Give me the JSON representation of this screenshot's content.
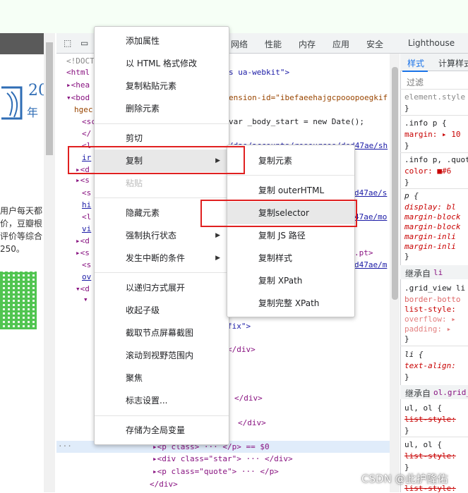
{
  "page": {
    "logo_num": "20",
    "logo_sub": "年度",
    "text_lines": [
      "用户每天都",
      "价，豆瓣根",
      "评价等综合",
      "250。"
    ]
  },
  "devtools": {
    "tabs": [
      "网络",
      "性能",
      "内存",
      "应用",
      "安全",
      "Lighthouse"
    ],
    "code": [
      {
        "a": "<!DOCT",
        "b": ""
      },
      {
        "a": "<html",
        "b": "s ua-webkit\">"
      },
      {
        "a": "▸<hea",
        "b": ""
      },
      {
        "a": "▾<bod",
        "b": "ension-id=\"ibefaeehajgcpooopoegkif"
      },
      {
        "a": "hgec",
        "b": ""
      },
      {
        "a": "<sc",
        "b": "var _body_start = new Date();"
      },
      {
        "a": "</",
        "b": ""
      },
      {
        "a": "<l",
        "b": "/dae/accounts/resources/ded47ae/sh"
      },
      {
        "a": "ir",
        "b": ""
      },
      {
        "a": "▸<d",
        "b": ""
      },
      {
        "a": "▸<s",
        "b": ""
      },
      {
        "a": "<s",
        "b": "d47ae/s"
      },
      {
        "a": "hi",
        "b": ""
      },
      {
        "a": "<l",
        "b": "47ae/mo"
      },
      {
        "a": "vi",
        "b": ""
      },
      {
        "a": "▸<d",
        "b": ""
      },
      {
        "a": "▸<s",
        "b": ".pt>"
      },
      {
        "a": "<s",
        "b": "d47ae/m"
      },
      {
        "a": "ov",
        "b": ""
      },
      {
        "a": "▾<d",
        "b": ""
      },
      {
        "a": "▾",
        "b": ""
      }
    ],
    "code_lower": [
      "fix\">",
      "</div>",
      "</div>",
      "</div>",
      "▸<p class> ··· </p> == $0",
      "▸<div class=\"star\"> ··· </div>",
      "▸<p class=\"quote\"> ··· </p>",
      "</div>"
    ],
    "ellipsis": "···"
  },
  "styles": {
    "tabs": [
      "样式",
      "计算样式"
    ],
    "filter_placeholder": "过滤",
    "lines": [
      "element.style {",
      "}",
      ".info p {",
      "  margin: ▸ 10",
      "}",
      ".info p, .quot",
      "  color: ■#6",
      "}",
      "p {",
      "  display: bl",
      "  margin-block",
      "  margin-block",
      "  margin-inli",
      "  margin-inli",
      "}"
    ],
    "inherited_1": "继承自",
    "inherited_1_sel": "li",
    "lines2": [
      ".grid_view li",
      "  border-botto",
      "  list-style:",
      "  overflow: ▸",
      "  padding: ▸",
      "}",
      "li {",
      "  text-align:",
      "}"
    ],
    "inherited_2": "继承自",
    "inherited_2_sel": "ol.grid_",
    "lines3": [
      "ul, ol {",
      "  list-style:",
      "}",
      "ul, ol {",
      "  list-style:",
      "}",
      "  list-style:"
    ]
  },
  "context_menu": {
    "items": [
      "添加属性",
      "以 HTML 格式修改",
      "复制粘贴元素",
      "删除元素",
      "剪切",
      "复制",
      "粘贴",
      "隐藏元素",
      "强制执行状态",
      "发生中断的条件",
      "以递归方式展开",
      "收起子级",
      "截取节点屏幕截图",
      "滚动到视野范围内",
      "聚焦",
      "标志设置...",
      "存储为全局变量"
    ]
  },
  "submenu": {
    "items": [
      "复制元素",
      "复制 outerHTML",
      "复制selector",
      "复制 JS 路径",
      "复制样式",
      "复制 XPath",
      "复制完整 XPath"
    ]
  },
  "watermark": "CSDN @此护隆佑"
}
